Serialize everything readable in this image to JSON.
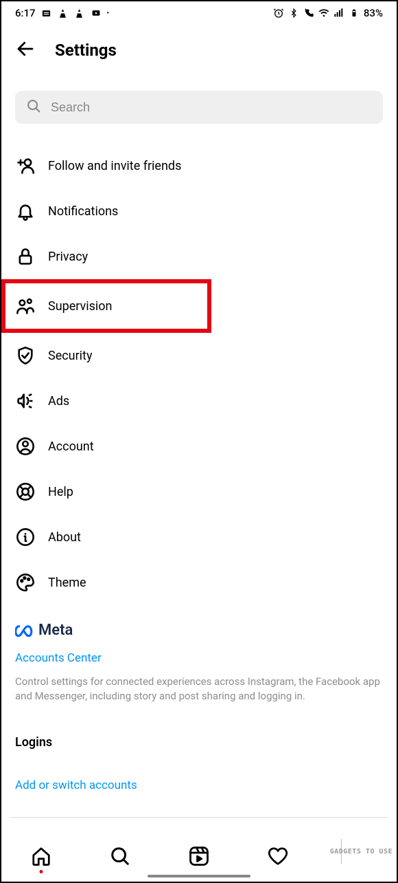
{
  "status": {
    "time": "6:17",
    "battery": "83%"
  },
  "header": {
    "title": "Settings"
  },
  "search": {
    "placeholder": "Search"
  },
  "items": {
    "follow": "Follow and invite friends",
    "notifications": "Notifications",
    "privacy": "Privacy",
    "supervision": "Supervision",
    "security": "Security",
    "ads": "Ads",
    "account": "Account",
    "help": "Help",
    "about": "About",
    "theme": "Theme"
  },
  "meta": {
    "brand": "Meta",
    "accounts_center": "Accounts Center",
    "description": "Control settings for connected experiences across Instagram, the Facebook app and Messenger, including story and post sharing and logging in."
  },
  "logins": {
    "heading": "Logins",
    "add_switch": "Add or switch accounts"
  },
  "watermark": "GADGETS TO USE"
}
